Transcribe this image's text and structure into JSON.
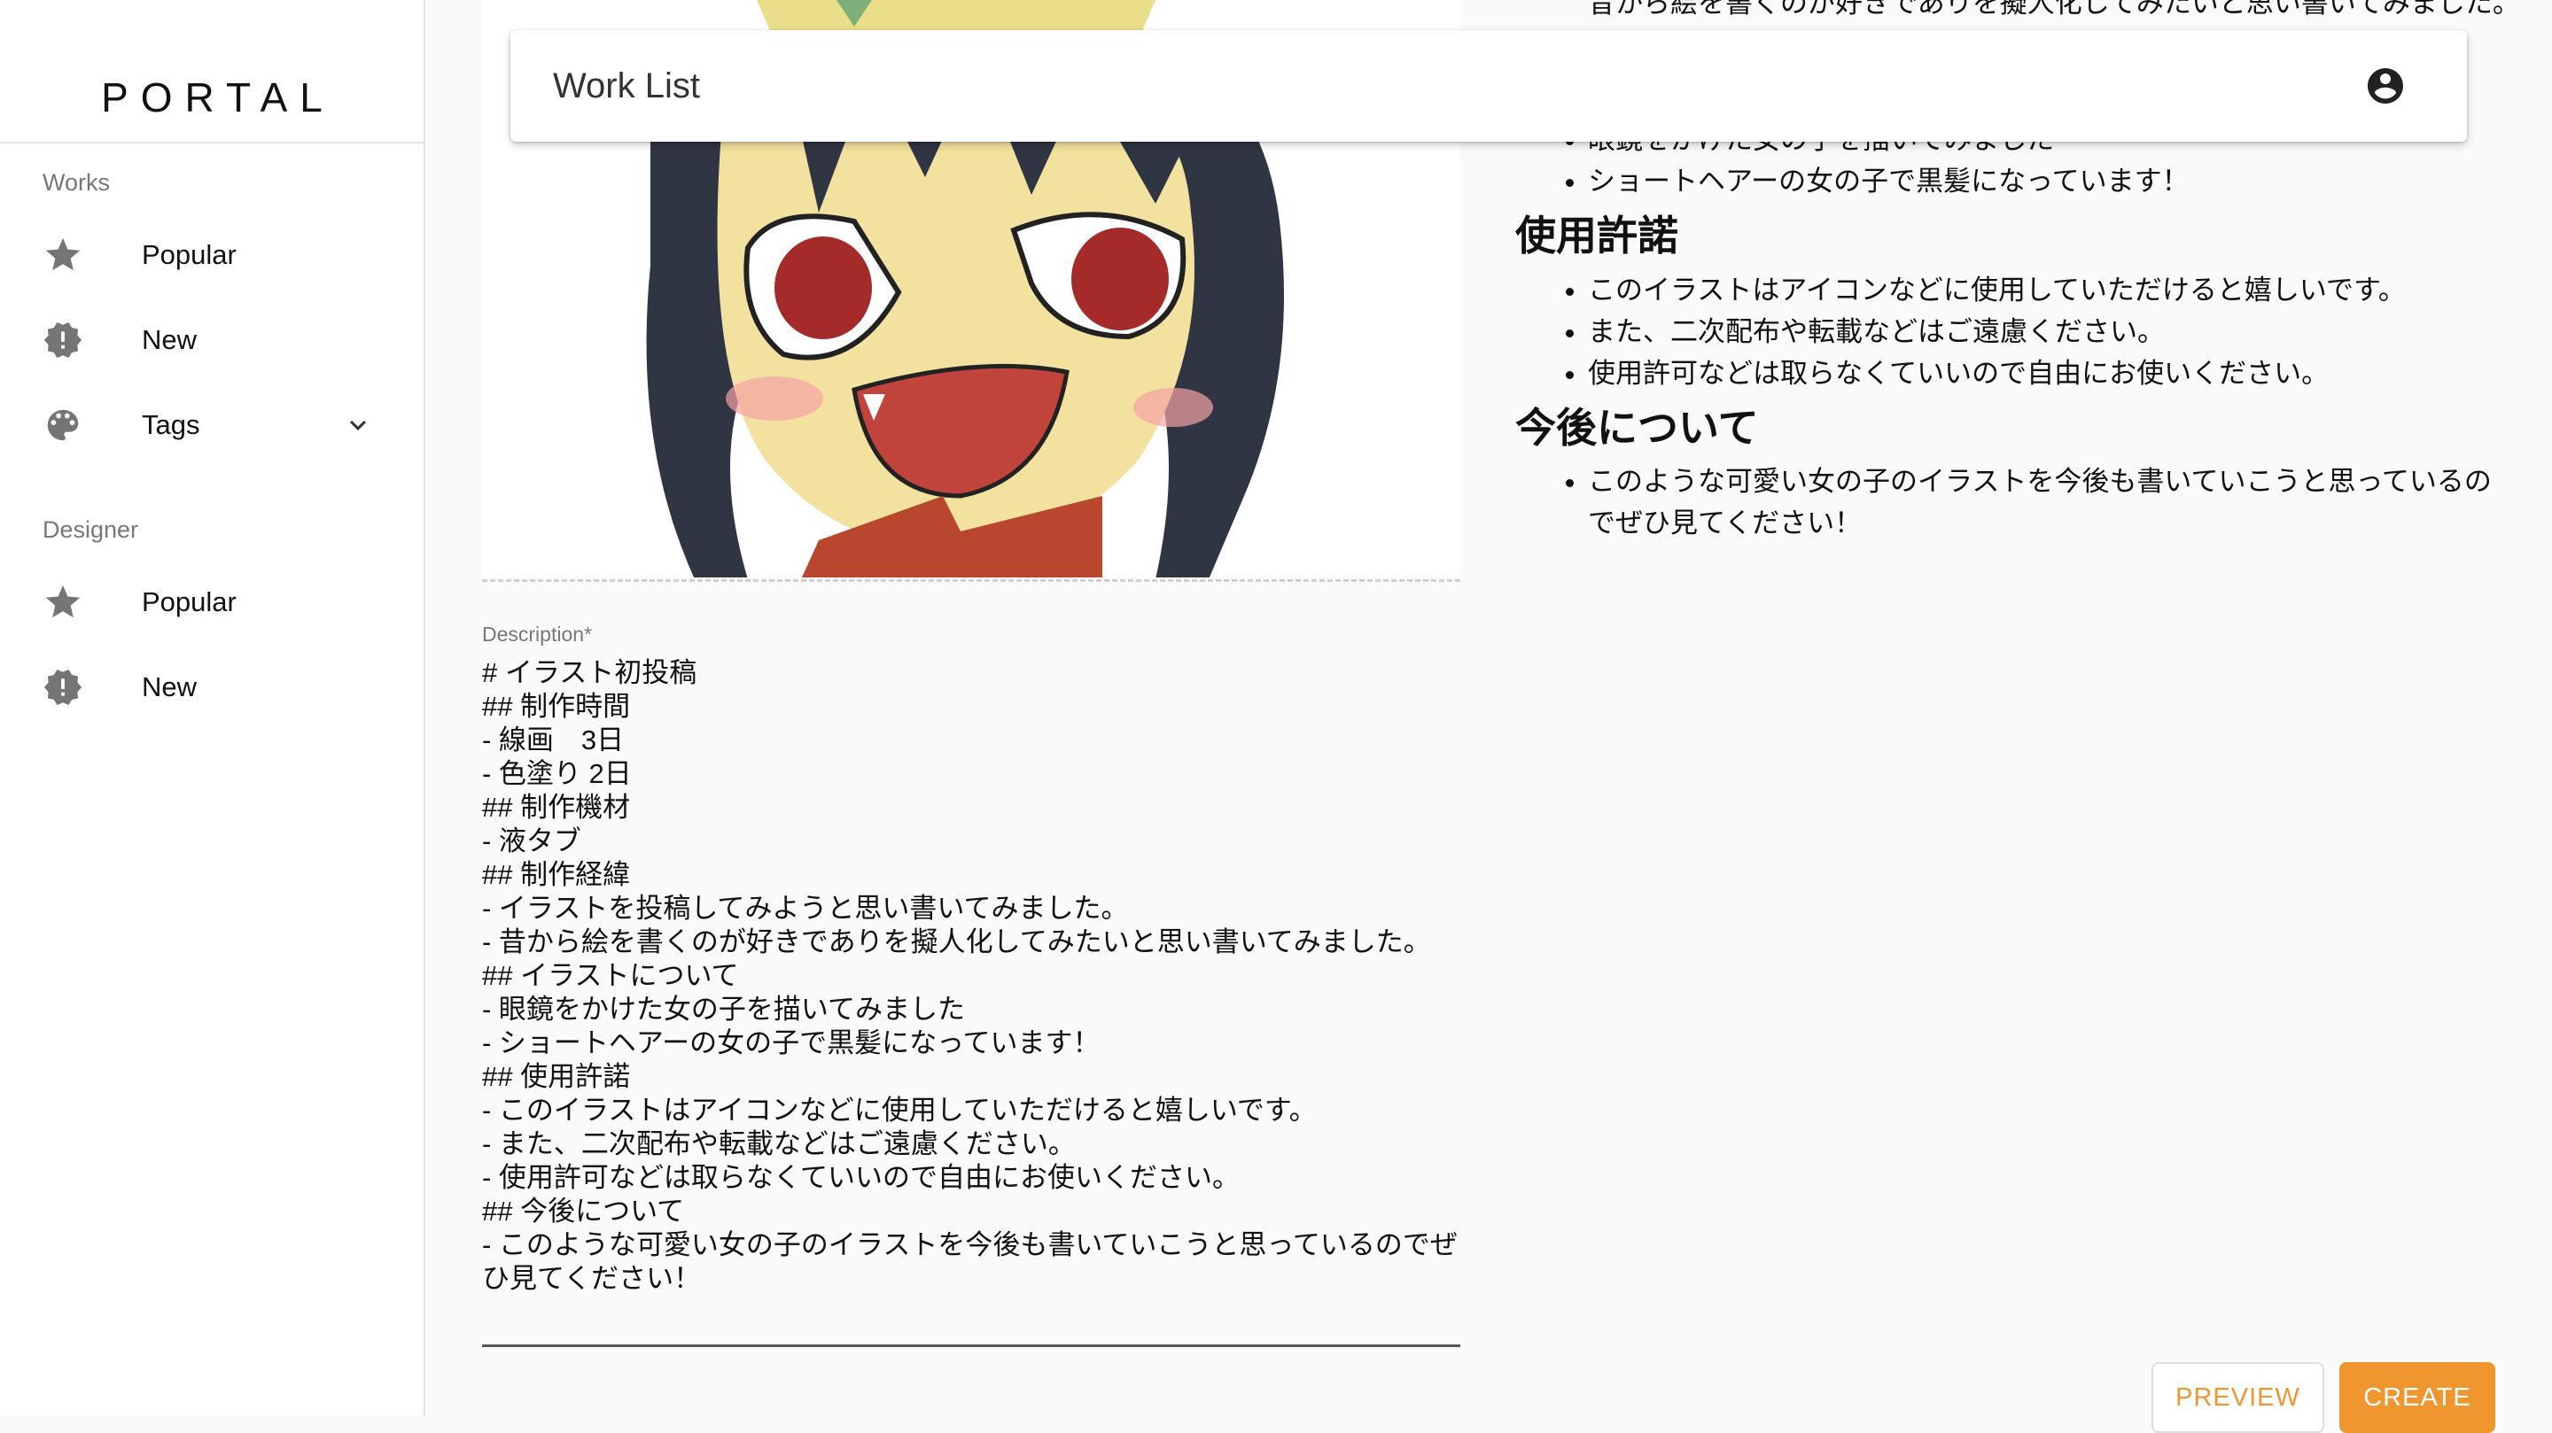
{
  "sidebar": {
    "brand": "PORTAL",
    "sections": [
      {
        "title": "Works",
        "items": [
          {
            "label": "Popular",
            "icon": "star-icon"
          },
          {
            "label": "New",
            "icon": "new-releases-icon"
          },
          {
            "label": "Tags",
            "icon": "palette-icon",
            "expandable": true
          }
        ]
      },
      {
        "title": "Designer",
        "items": [
          {
            "label": "Popular",
            "icon": "star-icon"
          },
          {
            "label": "New",
            "icon": "new-releases-icon"
          }
        ]
      }
    ]
  },
  "appbar": {
    "title": "Work List",
    "account_icon": "account-circle-icon"
  },
  "form": {
    "description_label": "Description",
    "description_required_mark": "*",
    "description_value": "# イラスト初投稿\n## 制作時間\n- 線画　3日\n- 色塗り 2日\n## 制作機材\n- 液タブ\n## 制作経緯\n- イラストを投稿してみようと思い書いてみました。\n- 昔から絵を書くのが好きでありを擬人化してみたいと思い書いてみました。\n## イラストについて\n- 眼鏡をかけた女の子を描いてみました\n- ショートヘアーの女の子で黒髪になっています！\n## 使用許諾\n- このイラストはアイコンなどに使用していただけると嬉しいです。\n- また、二次配布や転載などはご遠慮ください。\n- 使用許可などは取らなくていいので自由にお使いください。\n## 今後について\n- このような可愛い女の子のイラストを今後も書いていこうと思っているのでぜひ見てください！"
  },
  "preview": {
    "cutoff_top": "昔から絵を書くのが好きでありを擬人化してみたいと思い書いてみました。",
    "list1": [
      "眼鏡をかけた女の子を描いてみました",
      "ショートヘアーの女の子で黒髪になっています！"
    ],
    "heading1": "使用許諾",
    "list2": [
      "このイラストはアイコンなどに使用していただけると嬉しいです。",
      "また、二次配布や転載などはご遠慮ください。",
      "使用許可などは取らなくていいので自由にお使いください。"
    ],
    "heading2": "今後について",
    "list3": [
      "このような可愛い女の子のイラストを今後も書いていこうと思っているのでぜひ見てください！"
    ]
  },
  "buttons": {
    "preview": "PREVIEW",
    "create": "CREATE"
  },
  "colors": {
    "accent": "#f0962f",
    "icon_grey": "#757575"
  }
}
